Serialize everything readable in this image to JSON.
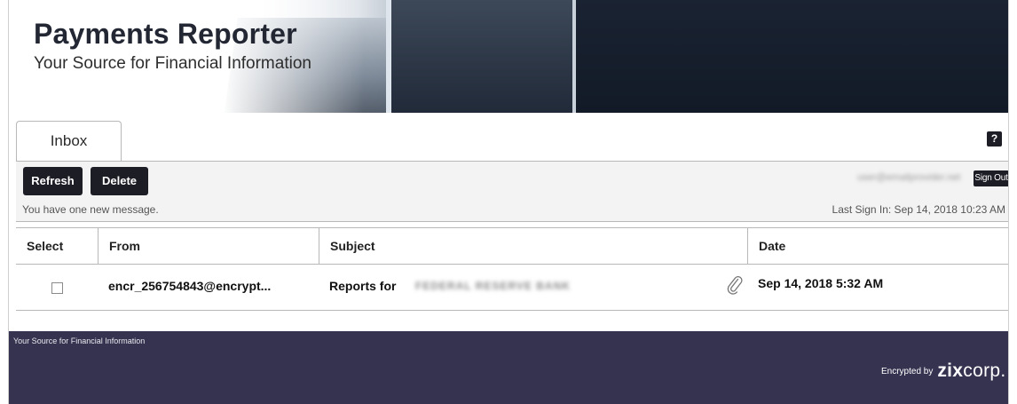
{
  "header": {
    "title": "Payments Reporter",
    "subtitle": "Your Source for Financial Information"
  },
  "tabs": [
    {
      "label": "Inbox",
      "active": true
    }
  ],
  "help": {
    "label": "?"
  },
  "toolbar": {
    "refresh_label": "Refresh",
    "delete_label": "Delete",
    "user_email": "user@emailprovider.net",
    "signout_label": "Sign Out",
    "status_message": "You have one new message.",
    "last_sign_in": "Last Sign In: Sep 14, 2018 10:23 AM"
  },
  "table": {
    "columns": [
      "Select",
      "From",
      "Subject",
      "Date"
    ],
    "rows": [
      {
        "selected": false,
        "from": "encr_256754843@encrypt...",
        "subject": "Reports for",
        "subject_redacted": "FEDERAL RESERVE BANK",
        "has_attachment": true,
        "date": "Sep 14, 2018 5:32 AM"
      }
    ]
  },
  "footer": {
    "tagline": "Your Source for Financial Information",
    "encrypted_by": "Encrypted by",
    "brand_bold": "zix",
    "brand_rest": "corp."
  },
  "colors": {
    "button_bg": "#1d1d26",
    "footer_bg": "#363350",
    "toolbar_bg": "#f3f3f3"
  }
}
